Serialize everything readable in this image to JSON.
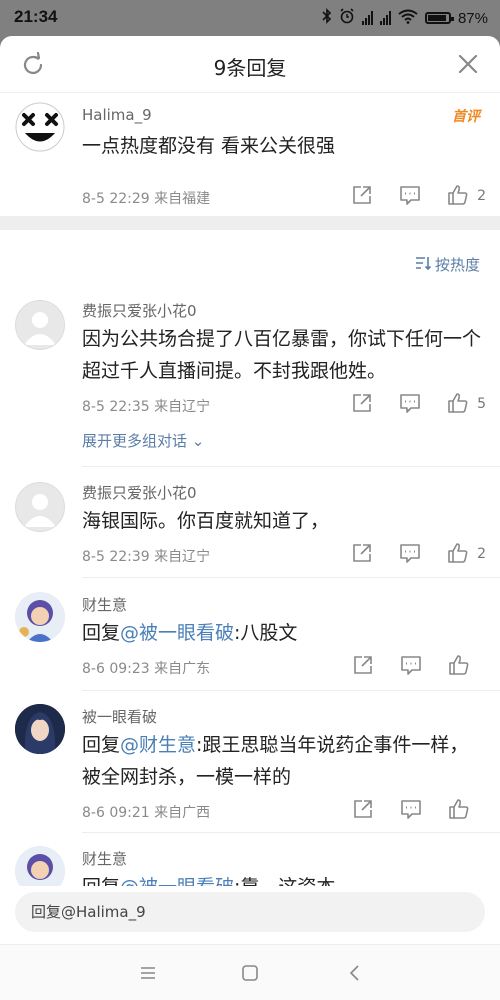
{
  "status_bar": {
    "time": "21:34",
    "battery": "87%"
  },
  "sheet": {
    "title": "9条回复"
  },
  "root_comment": {
    "username": "Halima_9",
    "badge": "首评",
    "text": "一点热度都没有 看来公关很强",
    "meta": "8-5 22:29 来自福建",
    "likes": "2"
  },
  "sort_label": "按热度",
  "expand_label": "展开更多组对话",
  "replies": [
    {
      "username": "费振只爱张小花0",
      "text": "因为公共场合提了八百亿暴雷，你试下任何一个超过千人直播间提。不封我跟他姓。",
      "meta": "8-5 22:35 来自辽宁",
      "likes": "5"
    },
    {
      "username": "费振只爱张小花0",
      "text": "海银国际。你百度就知道了，",
      "meta": "8-5 22:39 来自辽宁",
      "likes": "2"
    },
    {
      "username": "财生意",
      "prefix": "回复",
      "mention": "@被一眼看破",
      "text": ":八股文",
      "meta": "8-6 09:23 来自广东",
      "likes": ""
    },
    {
      "username": "被一眼看破",
      "prefix": "回复",
      "mention": "@财生意",
      "text": ":跟王思聪当年说药企事件一样，被全网封杀，一模一样的",
      "meta": "8-6 09:21 来自广西",
      "likes": ""
    },
    {
      "username": "财生意",
      "prefix": "回复",
      "mention": "@被一眼看破",
      "text": ":靠，这资本",
      "meta": "",
      "likes": ""
    }
  ],
  "reply_input": {
    "placeholder": "回复@Halima_9"
  },
  "icons": {
    "refresh": "refresh-icon",
    "close": "close-icon",
    "share": "share-icon",
    "comment": "comment-icon",
    "like": "thumbs-up-icon",
    "sort": "sort-icon",
    "nav_menu": "menu-icon",
    "nav_home": "home-icon",
    "nav_back": "back-icon"
  },
  "colors": {
    "accent_link": "#4a7fb8",
    "badge": "#f08a24",
    "meta": "#8a8a8a"
  }
}
